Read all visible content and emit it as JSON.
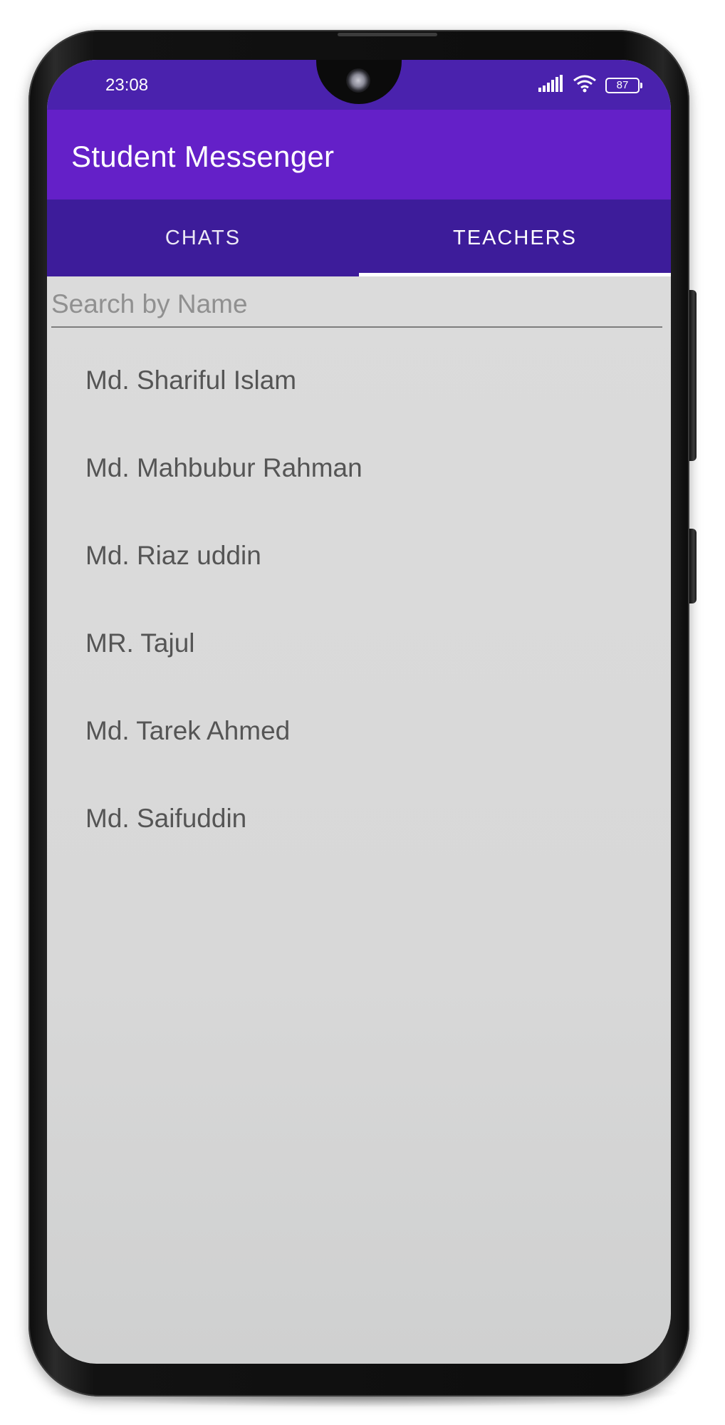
{
  "status_bar": {
    "time": "23:08",
    "battery": "87",
    "icons": [
      "signal-icon",
      "wifi-icon",
      "battery-icon"
    ]
  },
  "app_bar": {
    "title": "Student Messenger"
  },
  "tabs": [
    {
      "label": "CHATS",
      "active": false
    },
    {
      "label": "TEACHERS",
      "active": true
    }
  ],
  "search": {
    "placeholder": "Search by Name",
    "value": ""
  },
  "teachers": [
    "Md. Shariful Islam",
    "Md. Mahbubur Rahman",
    "Md. Riaz uddin",
    "MR. Tajul",
    "Md. Tarek Ahmed",
    "Md. Saifuddin"
  ],
  "colors": {
    "status_bar": "#4a22ad",
    "app_bar": "#6420c8",
    "tab_bar": "#3d1c9a",
    "background": "#dcdcdc",
    "list_text": "#555555"
  }
}
